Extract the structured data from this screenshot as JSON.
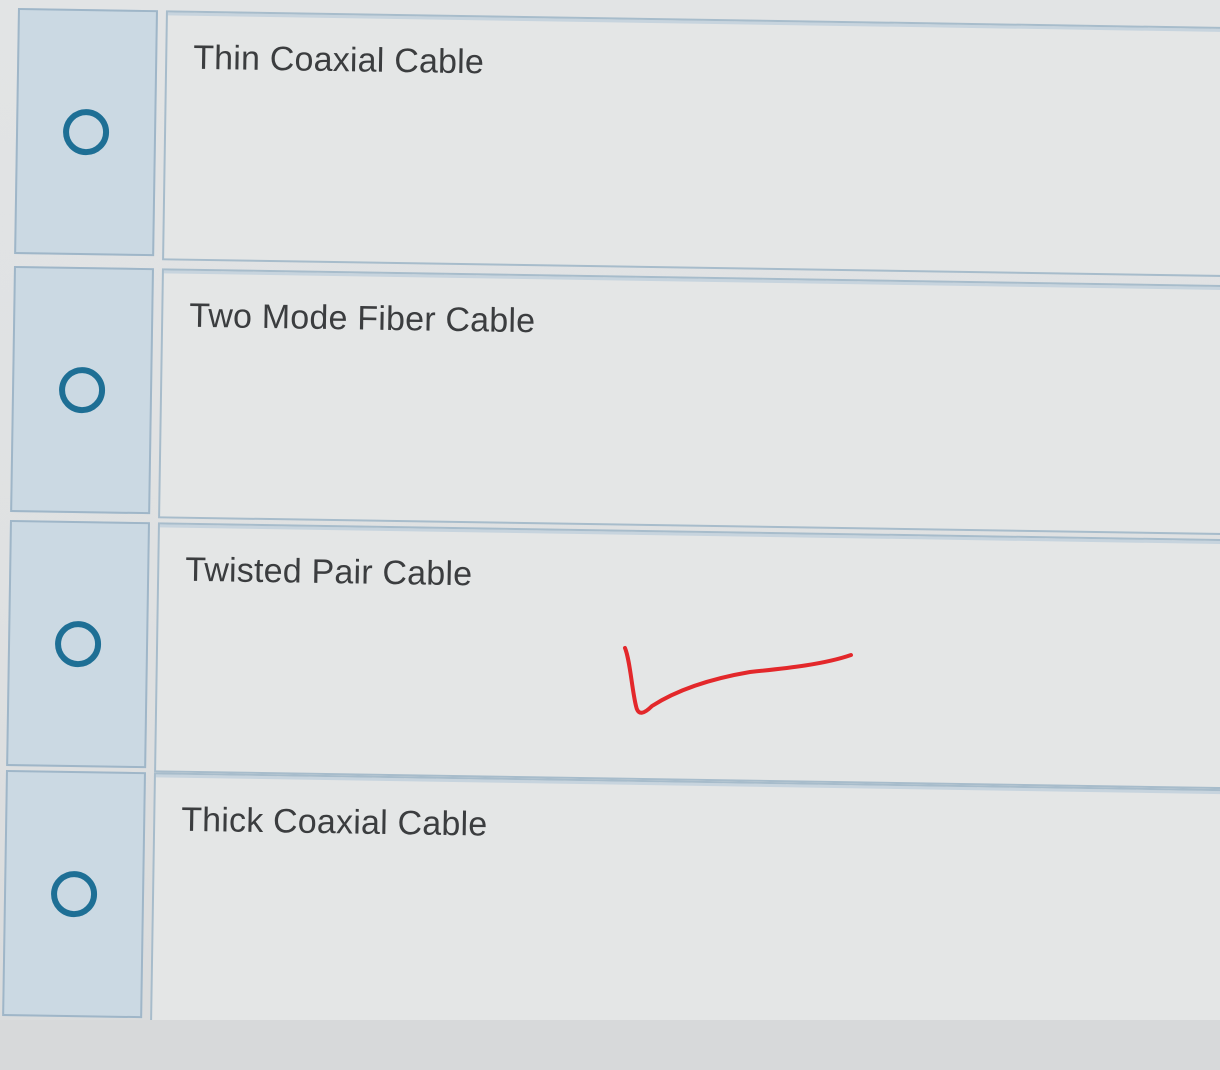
{
  "question": {
    "options": [
      {
        "label": "Thin Coaxial Cable",
        "selected": false
      },
      {
        "label": "Two Mode Fiber Cable",
        "selected": false
      },
      {
        "label": "Twisted Pair Cable",
        "selected": false
      },
      {
        "label": "Thick Coaxial Cable",
        "selected": false
      }
    ]
  },
  "annotation": {
    "type": "handwritten check mark",
    "color": "#e3282b",
    "next_to_option": "Twisted Pair Cable"
  },
  "colors": {
    "radio_ring": "#1e6f95",
    "radio_cell": "#cbd9e3",
    "answer_cell": "#e4e6e6",
    "border": "#a7bccb"
  }
}
